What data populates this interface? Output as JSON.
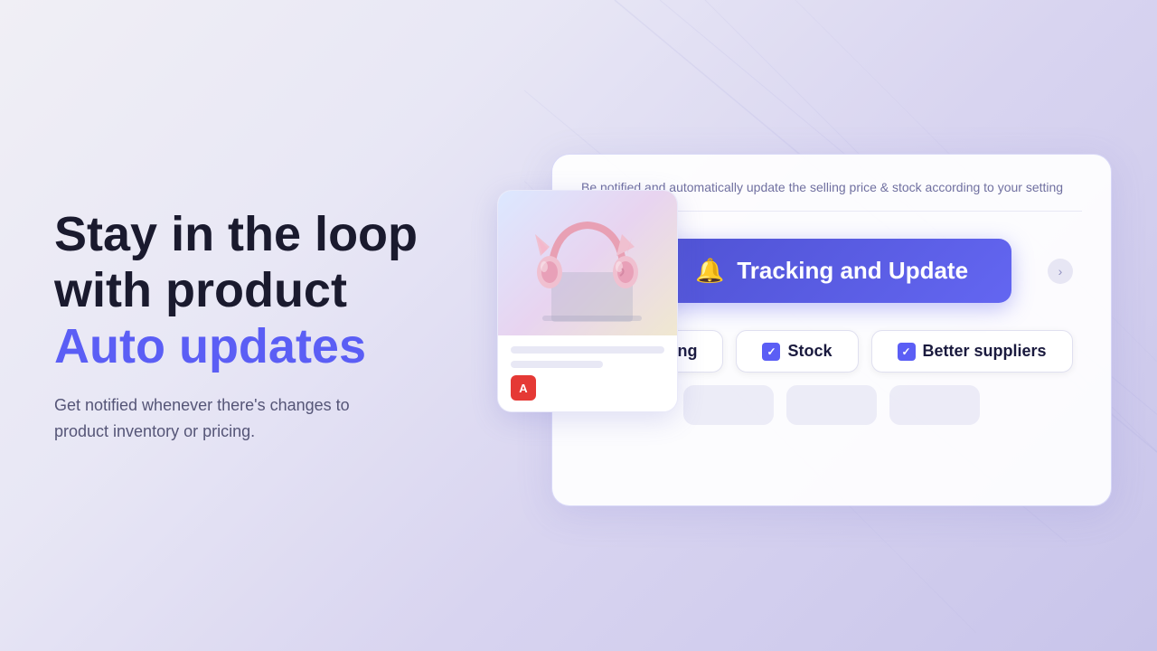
{
  "page": {
    "background": "gradient-light-purple"
  },
  "left": {
    "headline_line1": "Stay in the loop",
    "headline_line2": "with product",
    "headline_accent": "Auto updates",
    "subtext": "Get notified whenever there's changes to product inventory or pricing."
  },
  "card": {
    "description": "Be notified and automatically update the selling price & stock according to your setting",
    "tracking_button_label": "Tracking and Update",
    "bell_icon": "🔔",
    "chips": [
      {
        "label": "Pricing",
        "checked": true
      },
      {
        "label": "Stock",
        "checked": true
      },
      {
        "label": "Better suppliers",
        "checked": true
      }
    ],
    "placeholder_chips": [
      "",
      "",
      ""
    ]
  },
  "product": {
    "aliexpress_logo": "A"
  }
}
